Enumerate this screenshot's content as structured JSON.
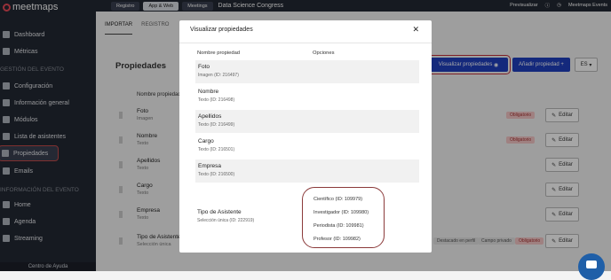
{
  "sidebar": {
    "logo": "meetmaps",
    "items_top": [
      {
        "label": "Dashboard"
      },
      {
        "label": "Métricas"
      }
    ],
    "section_event": "GESTIÓN DEL EVENTO",
    "items_event": [
      {
        "label": "Configuración"
      },
      {
        "label": "Información general"
      },
      {
        "label": "Módulos"
      },
      {
        "label": "Lista de asistentes"
      },
      {
        "label": "Propiedades"
      },
      {
        "label": "Emails"
      }
    ],
    "section_info": "INFORMACIÓN DEL EVENTO",
    "items_info": [
      {
        "label": "Home"
      },
      {
        "label": "Agenda"
      },
      {
        "label": "Streaming"
      }
    ],
    "help": "Centro de Ayuda"
  },
  "topbar": {
    "buttons": [
      "Registro",
      "App & Web",
      "Meetings"
    ],
    "event_title": "Data Science Congress",
    "preview": "Previsualizar",
    "user": "Meetmaps Events"
  },
  "page": {
    "tabs": [
      "IMPORTAR",
      "REGISTRO"
    ],
    "title": "Propiedades",
    "col_header": "Nombre propiedad",
    "btn_visualizar": "Visualizar propiedades",
    "btn_add": "Añadir propiedad",
    "lang": "ES",
    "edit_label": "Editar",
    "rows": [
      {
        "name": "Foto",
        "type": "Imagen",
        "badge": "Obligatorio"
      },
      {
        "name": "Nombre",
        "type": "Texto",
        "badge": "Obligatorio"
      },
      {
        "name": "Apellidos",
        "type": "Texto",
        "badge": ""
      },
      {
        "name": "Cargo",
        "type": "Texto",
        "badge": ""
      },
      {
        "name": "Empresa",
        "type": "Texto",
        "badge": ""
      },
      {
        "name": "Tipo de Asistente",
        "type": "Selección única",
        "badge": ""
      }
    ],
    "last_row_tags": [
      "Destacado en perfil",
      "Campo privado",
      "Obligatorio"
    ]
  },
  "modal": {
    "title": "Visualizar propiedades",
    "col_name": "Nombre propiedad",
    "col_options": "Opciones",
    "rows": [
      {
        "name": "Foto",
        "type": "Imagen (ID: 216497)"
      },
      {
        "name": "Nombre",
        "type": "Texto (ID: 216498)"
      },
      {
        "name": "Apellidos",
        "type": "Texto (ID: 216499)"
      },
      {
        "name": "Cargo",
        "type": "Texto (ID: 216501)"
      },
      {
        "name": "Empresa",
        "type": "Texto (ID: 216500)"
      }
    ],
    "tipo": {
      "name": "Tipo de Asistente",
      "type": "Selección única (ID: 222919)"
    },
    "options": [
      "Científico (ID: 109979)",
      "Investigador (ID: 109980)",
      "Periodista (ID: 109981)",
      "Profesor (ID: 109982)"
    ]
  }
}
